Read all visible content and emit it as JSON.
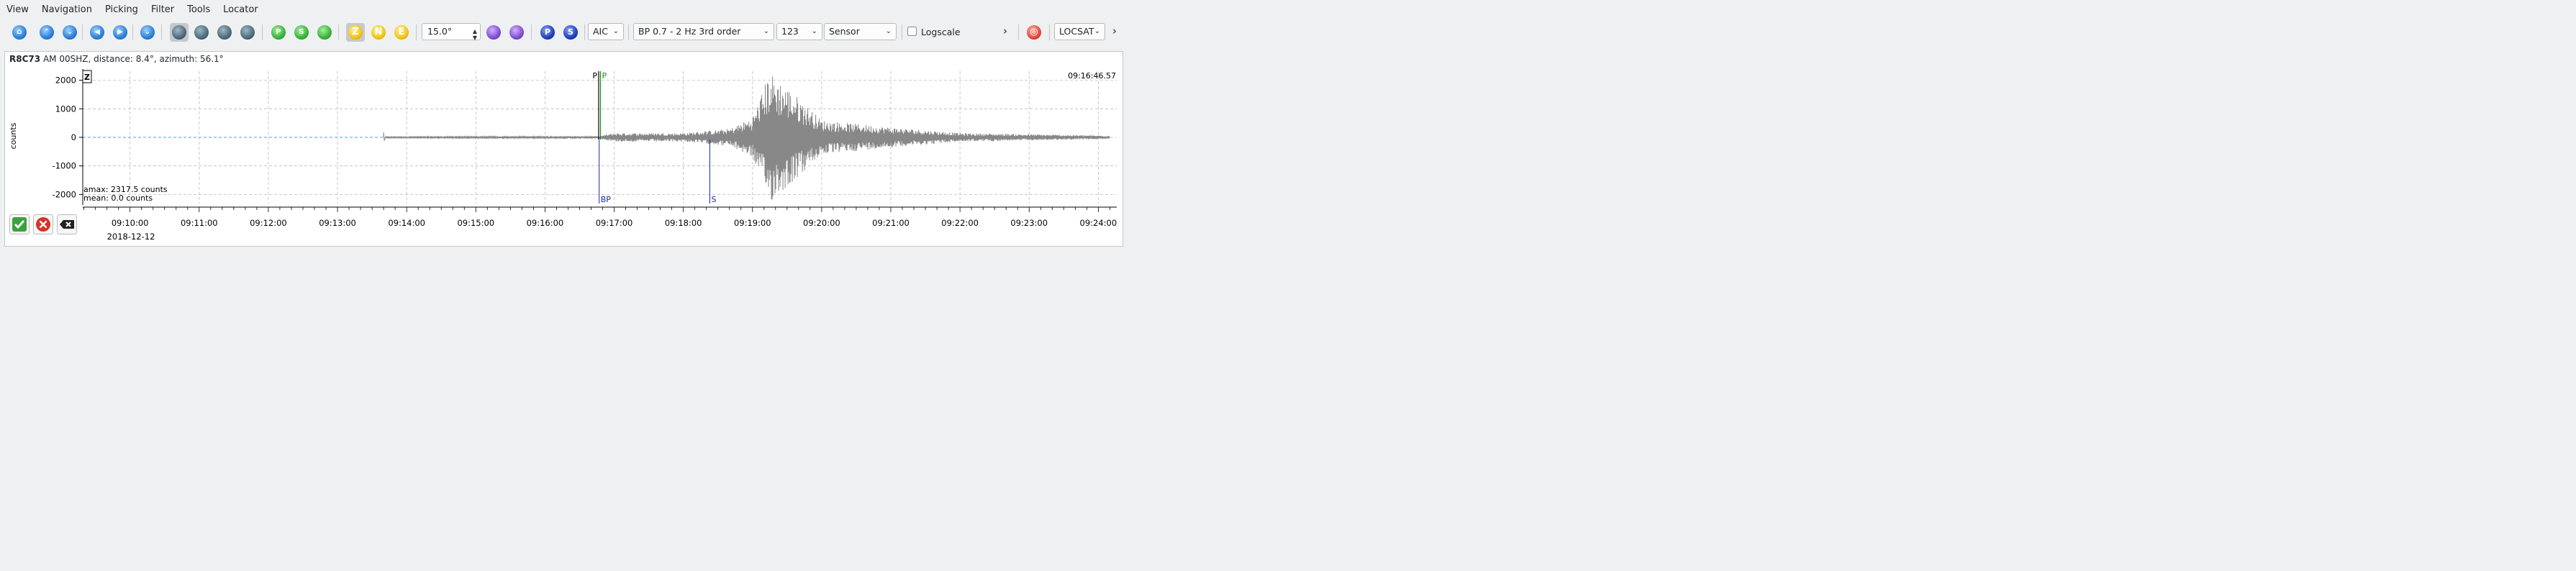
{
  "menubar": {
    "items": [
      "View",
      "Navigation",
      "Picking",
      "Filter",
      "Tools",
      "Locator"
    ]
  },
  "toolbar": {
    "buttons": [
      {
        "name": "home-icon",
        "glyph": "⌂"
      },
      {
        "name": "scroll-up-icon",
        "glyph": "⌃"
      },
      {
        "name": "scroll-down-icon",
        "glyph": "⌄"
      },
      {
        "name": "prev-icon",
        "glyph": "◀"
      },
      {
        "name": "next-icon",
        "glyph": "▶"
      },
      {
        "name": "sort-icon",
        "glyph": "⌄"
      },
      {
        "name": "pick-tool-icon",
        "glyph": ""
      },
      {
        "name": "measure-tool-icon",
        "glyph": ""
      },
      {
        "name": "zoom-tool-icon",
        "glyph": ""
      },
      {
        "name": "print-tool-icon",
        "glyph": ""
      },
      {
        "name": "pick-p-icon",
        "glyph": "P"
      },
      {
        "name": "pick-s-icon",
        "glyph": "S"
      },
      {
        "name": "pick-auto-icon",
        "glyph": ""
      }
    ],
    "component_buttons": [
      "Z",
      "N",
      "E"
    ],
    "rotation_value": "15.0°",
    "phase_buttons": [
      "P",
      "S"
    ],
    "method": "AIC",
    "filter": "BP 0.7 - 2 Hz  3rd order",
    "channels": "123",
    "unit": "Sensor",
    "logscale_label": "Logscale",
    "more_glyph": "›",
    "locator": "LOCSAT",
    "locator_more_glyph": "›"
  },
  "trace": {
    "station": "R8C73",
    "info": "AM  00SHZ, distance: 8.4°, azimuth: 56.1°",
    "component_label": "Z",
    "time_label": "09:16:46.57",
    "amax_text": "amax: 2317.5 counts",
    "mean_text": "mean: 0.0 counts",
    "date_label": "2018-12-12",
    "picks": [
      {
        "label": "P",
        "time": "09:16:46.57",
        "color": "#000000"
      },
      {
        "label": "P",
        "time": "09:16:47.20",
        "color": "#1a8a1a"
      }
    ],
    "theoretical": [
      {
        "label": "BP",
        "time": "09:16:47.00"
      },
      {
        "label": "S",
        "time": "09:18:23.00"
      }
    ]
  },
  "chart_data": {
    "type": "line",
    "title": "",
    "xlabel": "",
    "ylabel": "counts",
    "y_ticks": [
      2000,
      1000,
      0,
      -1000,
      -2000
    ],
    "ylim": [
      -2317.5,
      2317.5
    ],
    "x_ticks": [
      "09:10:00",
      "09:11:00",
      "09:12:00",
      "09:13:00",
      "09:14:00",
      "09:15:00",
      "09:16:00",
      "09:17:00",
      "09:18:00",
      "09:19:00",
      "09:20:00",
      "09:21:00",
      "09:22:00",
      "09:23:00",
      "09:24:00"
    ],
    "xlim": [
      "09:09:19",
      "09:24:16"
    ],
    "grid": true,
    "series": [
      {
        "color": "#888888",
        "envelope": [
          {
            "t": "09:13:40",
            "amp": 20
          },
          {
            "t": "09:16:46",
            "amp": 40
          },
          {
            "t": "09:17:00",
            "amp": 150
          },
          {
            "t": "09:18:00",
            "amp": 150
          },
          {
            "t": "09:18:40",
            "amp": 300
          },
          {
            "t": "09:19:00",
            "amp": 700
          },
          {
            "t": "09:19:15",
            "amp": 2300
          },
          {
            "t": "09:19:40",
            "amp": 1400
          },
          {
            "t": "09:20:00",
            "amp": 600
          },
          {
            "t": "09:21:00",
            "amp": 350
          },
          {
            "t": "09:22:00",
            "amp": 150
          },
          {
            "t": "09:24:10",
            "amp": 60
          }
        ]
      }
    ]
  },
  "controls": [
    "accept-icon",
    "reject-icon",
    "delete-icon"
  ],
  "colors": {
    "trace": "#888888",
    "pick_p": "#000000",
    "pick_p2": "#1a8a1a",
    "theory": "#1c2a9e",
    "noise_line": "#4aa3df",
    "grid": "#bbbbbb"
  }
}
